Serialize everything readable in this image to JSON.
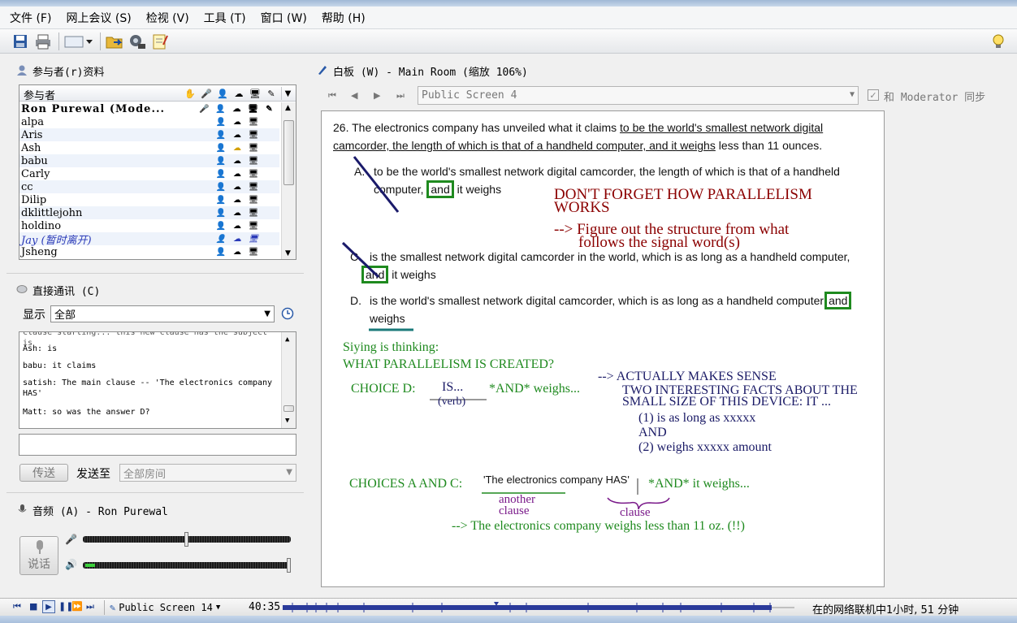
{
  "menu": [
    "文件 (F)",
    "网上会议 (S)",
    "检视 (V)",
    "工具 (T)",
    "窗口 (W)",
    "帮助 (H)"
  ],
  "toolbar": {
    "icons": [
      "save-icon",
      "print-icon",
      "view-dropdown-icon",
      "folder-open-icon",
      "webcam-icon",
      "notes-icon",
      "lightbulb-icon"
    ]
  },
  "participants": {
    "title": "参与者(r)资料",
    "header_label": "参与者",
    "rows": [
      "Ron Purewal (Mode...",
      "alpa",
      "Aris",
      "Ash",
      "babu",
      "Carly",
      "cc",
      "Dilip",
      "dklittlejohn",
      "holdino",
      "Jay (暂时离开)",
      "Jsheng"
    ]
  },
  "chat": {
    "title": "直接通讯 (C)",
    "display_label": "显示",
    "display_value": "全部",
    "lines": [
      "clause starting... this new clause has the subject is",
      "Ash: is",
      "babu: it claims",
      "satish: The main clause -- 'The electronics company HAS'",
      "Matt: so was the answer D?"
    ],
    "send_label": "传送",
    "send_to_label": "发送至",
    "send_to_value": "全部房间"
  },
  "audio": {
    "title": "音频 (A) - Ron Purewal",
    "talk_label": "说话",
    "mic_level": 0.5,
    "speaker_level": 1.0
  },
  "whiteboard": {
    "title": "白板 (W) - Main Room (缩放 106%)",
    "screen_select": "Public Screen 4",
    "sync_label": "和 Moderator 同步",
    "question_number": "26.",
    "question_text_plain": "The electronics company has unveiled what it claims",
    "question_text_underlined_1": "to be the world's smallest network digital",
    "question_text_underlined_2": "camcorder, the length of which is that of a handheld computer, and it weighs",
    "question_text_end": "less than 11 ounces.",
    "choice_a_letter": "A.",
    "choice_a_1": "to be the world's smallest network digital camcorder, the length of which is that of a handheld",
    "choice_a_2_pre": "computer,",
    "choice_a_2_and": "and",
    "choice_a_2_post": "it weighs",
    "choice_c_letter": "C.",
    "choice_c_1": "is the smallest network digital camcorder in the world, which is as long as a handheld computer,",
    "choice_c_2_and": "and",
    "choice_c_2_post": "it weighs",
    "choice_d_letter": "D.",
    "choice_d_1": "is the world's smallest network digital camcorder, which is as long as a handheld computer",
    "choice_d_1_and": "and",
    "choice_d_2": "weighs",
    "note_red_1": "DON'T FORGET HOW PARALLELISM",
    "note_red_2": "WORKS",
    "note_red_3": "--> Figure out the structure from what",
    "note_red_4": "follows the signal word(s)",
    "siying": "Siying is thinking:",
    "parallel_q": "WHAT PARALLELISM IS CREATED?",
    "choice_d_label": "CHOICE D:",
    "is_text": "IS...",
    "verb_text": "(verb)",
    "and_weighs": "*AND* weighs...",
    "makes_sense": "--> ACTUALLY MAKES SENSE",
    "two_facts_1": "TWO INTERESTING FACTS ABOUT THE",
    "two_facts_2": "SMALL SIZE OF THIS DEVICE:  IT ...",
    "fact_1": "(1) is as long as xxxxx",
    "fact_and": "AND",
    "fact_2": "(2) weighs xxxxx amount",
    "choices_ac": "CHOICES A AND C:",
    "company_has": "'The electronics company HAS'",
    "and_it_weighs": "*AND* it weighs...",
    "another_clause_1": "another",
    "another_clause_2": "clause",
    "clause": "clause",
    "conclusion": "--> The electronics company weighs less than 11 oz. (!!)"
  },
  "status": {
    "screen": "Public Screen 14",
    "time": "40:35",
    "online": "在的网络联机中1小时, 51 分钟",
    "progress": 0.64
  }
}
